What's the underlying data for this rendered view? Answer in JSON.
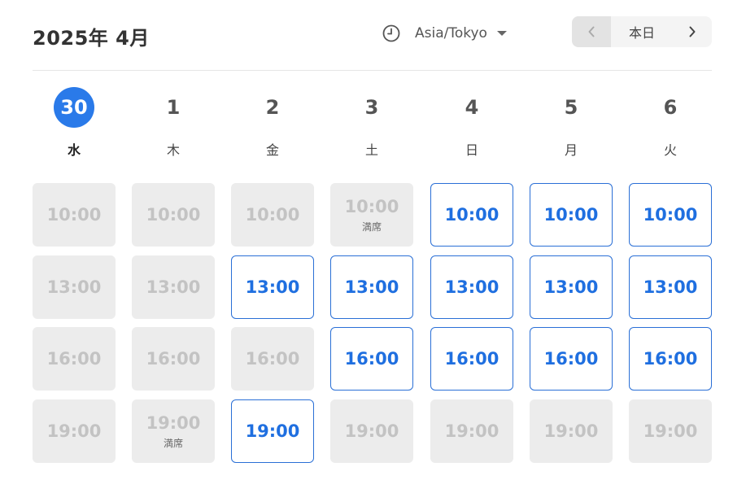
{
  "header": {
    "title": "2025年 4月",
    "timezone": "Asia/Tokyo",
    "today_label": "本日"
  },
  "colors": {
    "accent": "#2a7ae9",
    "available_border": "#2a6fd6",
    "available_text": "#1f6fe0",
    "unavailable_bg": "#ececec",
    "unavailable_text": "#c3c3c3"
  },
  "days": [
    {
      "num": "30",
      "weekday": "水",
      "today": true
    },
    {
      "num": "1",
      "weekday": "木",
      "today": false
    },
    {
      "num": "2",
      "weekday": "金",
      "today": false
    },
    {
      "num": "3",
      "weekday": "土",
      "today": false
    },
    {
      "num": "4",
      "weekday": "日",
      "today": false
    },
    {
      "num": "5",
      "weekday": "月",
      "today": false
    },
    {
      "num": "6",
      "weekday": "火",
      "today": false
    }
  ],
  "full_label": "満席",
  "slots": [
    [
      {
        "time": "10:00",
        "available": false,
        "full": false
      },
      {
        "time": "13:00",
        "available": false,
        "full": false
      },
      {
        "time": "16:00",
        "available": false,
        "full": false
      },
      {
        "time": "19:00",
        "available": false,
        "full": false
      }
    ],
    [
      {
        "time": "10:00",
        "available": false,
        "full": false
      },
      {
        "time": "13:00",
        "available": false,
        "full": false
      },
      {
        "time": "16:00",
        "available": false,
        "full": false
      },
      {
        "time": "19:00",
        "available": false,
        "full": true
      }
    ],
    [
      {
        "time": "10:00",
        "available": false,
        "full": false
      },
      {
        "time": "13:00",
        "available": true,
        "full": false
      },
      {
        "time": "16:00",
        "available": false,
        "full": false
      },
      {
        "time": "19:00",
        "available": true,
        "full": false
      }
    ],
    [
      {
        "time": "10:00",
        "available": false,
        "full": true
      },
      {
        "time": "13:00",
        "available": true,
        "full": false
      },
      {
        "time": "16:00",
        "available": true,
        "full": false
      },
      {
        "time": "19:00",
        "available": false,
        "full": false
      }
    ],
    [
      {
        "time": "10:00",
        "available": true,
        "full": false
      },
      {
        "time": "13:00",
        "available": true,
        "full": false
      },
      {
        "time": "16:00",
        "available": true,
        "full": false
      },
      {
        "time": "19:00",
        "available": false,
        "full": false
      }
    ],
    [
      {
        "time": "10:00",
        "available": true,
        "full": false
      },
      {
        "time": "13:00",
        "available": true,
        "full": false
      },
      {
        "time": "16:00",
        "available": true,
        "full": false
      },
      {
        "time": "19:00",
        "available": false,
        "full": false
      }
    ],
    [
      {
        "time": "10:00",
        "available": true,
        "full": false
      },
      {
        "time": "13:00",
        "available": true,
        "full": false
      },
      {
        "time": "16:00",
        "available": true,
        "full": false
      },
      {
        "time": "19:00",
        "available": false,
        "full": false
      }
    ]
  ]
}
